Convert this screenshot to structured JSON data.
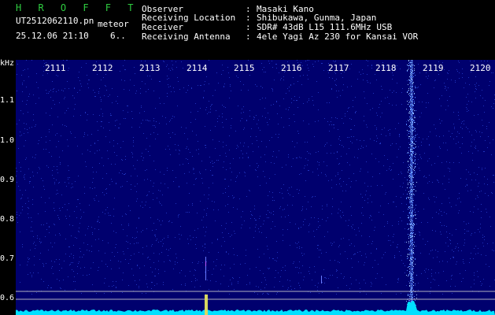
{
  "header": {
    "brand": "H R O F F T",
    "filename": "UT2512062110.pn",
    "meteor_label": "meteor",
    "datetime": "25.12.06 21:10",
    "count": "6..",
    "observer": {
      "label": "Observer",
      "value": "Masaki Kano"
    },
    "location": {
      "label": "Receiving Location",
      "value": "Shibukawa, Gunma, Japan"
    },
    "receiver": {
      "label": "Receiver",
      "value": "SDR# 43dB L15 111.6MHz USB"
    },
    "antenna": {
      "label": "Receiving Antenna",
      "value": "4ele Yagi Az 230 for Kansai VOR"
    },
    "colon": ":"
  },
  "spectrogram": {
    "y_unit": "kHz",
    "y_ticks": [
      "1.1",
      "1.0",
      "0.9",
      "0.8",
      "0.7",
      "0.6"
    ],
    "x_ticks": [
      "2111",
      "2112",
      "2113",
      "2114",
      "2115",
      "2116",
      "2117",
      "2118",
      "2119",
      "2120"
    ],
    "colors": {
      "background": "#00006e",
      "noise": "#3a5cff",
      "echo": "#d8d860",
      "baseline": "#00e0ff"
    }
  }
}
